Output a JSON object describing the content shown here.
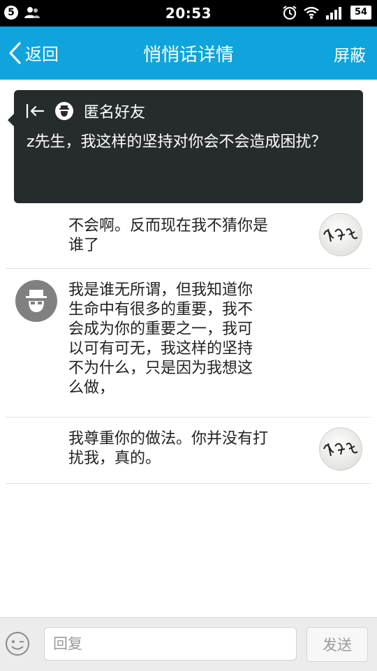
{
  "status_bar": {
    "notification_count": "5",
    "time": "20:53",
    "battery": "54",
    "icons": [
      "notification-badge-icon",
      "contacts-icon",
      "alarm-icon",
      "wifi-icon",
      "signal-icon",
      "battery-icon"
    ]
  },
  "header": {
    "back_label": "返回",
    "title": "悄悄话详情",
    "block_label": "屏蔽",
    "accent_color": "#0fa4dc"
  },
  "popup": {
    "sender_name": "匿名好友",
    "message": "z先生，我这样的坚持对你会不会造成困扰？",
    "background_color": "#262b2d"
  },
  "messages": [
    {
      "side": "right",
      "avatar": "signature-avatar",
      "text_line1": "不会啊。反而现在我不猜你是",
      "text_line2": "谁了"
    },
    {
      "side": "left",
      "avatar": "anonymous-avatar",
      "lines": [
        "我是谁无所谓，但我知道你",
        "生命中有很多的重要，我不",
        "会成为你的重要之一，我可",
        "以可有可无，我这样的坚持",
        "不为什么，只是因为我想这",
        "么做，"
      ]
    },
    {
      "side": "right",
      "avatar": "signature-avatar",
      "text_line1": "我尊重你的做法。你并没有打",
      "text_line2": "扰我，真的。"
    }
  ],
  "input_bar": {
    "placeholder": "回复",
    "send_label": "发送"
  }
}
